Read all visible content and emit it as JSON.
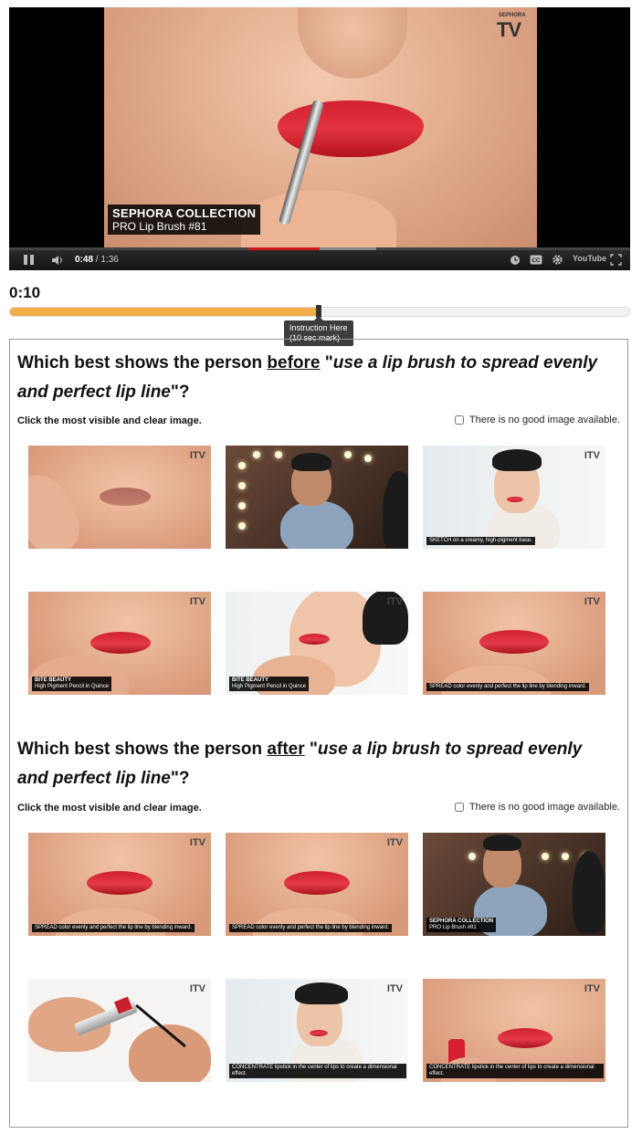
{
  "player": {
    "logo_small": "SEPHORA",
    "logo_tv": "TV",
    "caption_line1": "SEPHORA COLLECTION",
    "caption_line2": "PRO Lip Brush #81",
    "time_current": "0:48",
    "time_total": " / 1:36",
    "progress_played": 0.5,
    "youtube_label": "YouTube"
  },
  "timer": {
    "value": "0:10",
    "slider_fraction": 0.5
  },
  "tooltip": {
    "line1": "Instruction Here",
    "line2": "(10 sec mark)"
  },
  "questions": [
    {
      "prefix": "Which best shows the person ",
      "keyword": "before",
      "middle": " \"",
      "phrase": "use a lip brush to spread evenly and perfect lip line",
      "suffix": "\"?",
      "instruction": "Click the most visible and clear image.",
      "no_image_label": "There is no good image available.",
      "thumbnails": [
        {
          "caption_bold": "",
          "caption": ""
        },
        {
          "caption_bold": "",
          "caption": ""
        },
        {
          "caption_bold": "",
          "caption": "SKETCH on a creamy, high-pigment base."
        },
        {
          "caption_bold": "BITE BEAUTY",
          "caption": "High Pigment Pencil in Quince"
        },
        {
          "caption_bold": "BITE BEAUTY",
          "caption": "High Pigment Pencil in Quince"
        },
        {
          "caption_bold": "",
          "caption": "SPREAD color evenly and perfect the lip line by blending inward."
        }
      ]
    },
    {
      "prefix": "Which best shows the person ",
      "keyword": "after",
      "middle": " \"",
      "phrase": "use a lip brush to spread evenly and perfect lip line",
      "suffix": "\"?",
      "instruction": "Click the most visible and clear image.",
      "no_image_label": "There is no good image available.",
      "thumbnails": [
        {
          "caption_bold": "",
          "caption": "SPREAD color evenly and perfect the lip line by blending inward."
        },
        {
          "caption_bold": "",
          "caption": "SPREAD color evenly and perfect the lip line by blending inward."
        },
        {
          "caption_bold": "SEPHORA COLLECTION",
          "caption": "PRO Lip Brush #81"
        },
        {
          "caption_bold": "",
          "caption": ""
        },
        {
          "caption_bold": "",
          "caption": "CONCENTRATE lipstick in the center of lips to create a dimensional effect."
        },
        {
          "caption_bold": "",
          "caption": "CONCENTRATE lipstick in the center of lips to create a dimensional effect."
        }
      ]
    }
  ],
  "thumb_logo": "ITV",
  "colors": {
    "accent_orange": "#f2ad46",
    "lip_red": "#d8202f",
    "progress_red": "#cc181e"
  }
}
